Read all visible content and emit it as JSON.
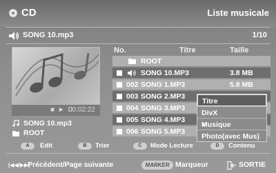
{
  "header": {
    "title": "CD",
    "right_title": "Liste musicale"
  },
  "now_playing": {
    "song": "SONG 10.mp3",
    "count": "1/10"
  },
  "player": {
    "controls": "■ ► II",
    "time": "00:02:22"
  },
  "info": {
    "track": "SONG 10.mp3",
    "folder": "ROOT"
  },
  "list": {
    "columns": {
      "no": "No.",
      "title": "Titre",
      "size": "Taille"
    },
    "root_label": "ROOT",
    "rows": [
      {
        "num": "",
        "name": "SONG 10.MP3",
        "size": "3.8 MB",
        "playing": true
      },
      {
        "num": "002",
        "name": "SONG 1.MP3",
        "size": "5.8 MB"
      },
      {
        "num": "003",
        "name": "SONG 2.MP3",
        "size": ""
      },
      {
        "num": "004",
        "name": "SONG 3.MP3",
        "size": ""
      },
      {
        "num": "005",
        "name": "SONG 4.MP3",
        "size": ""
      },
      {
        "num": "006",
        "name": "SONG 5.MP3",
        "size": ""
      }
    ]
  },
  "popup": {
    "options": [
      "Titre",
      "DivX",
      "Musique",
      "Photo(avec Mus)"
    ],
    "selected": "Titre",
    "checked": "Musique",
    "check_mark": "✓"
  },
  "buttons": {
    "a": {
      "key": "A",
      "label": "Edit"
    },
    "b": {
      "key": "B",
      "label": "Trier"
    },
    "c": {
      "key": "C",
      "label": "Mode Lecture"
    },
    "d": {
      "key": "D",
      "label": "Contenu"
    }
  },
  "footer": {
    "nav": "Précédent/Page suivante",
    "nav_icon": "|◀◀/▶▶|",
    "marker_key": "MARKER",
    "marker_label": "Marqueur",
    "exit": "SORTIE"
  }
}
